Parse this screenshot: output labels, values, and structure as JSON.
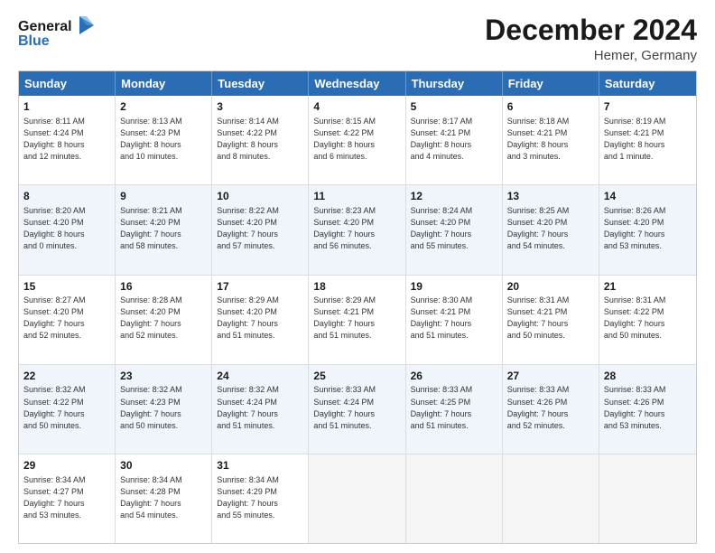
{
  "header": {
    "logo_general": "General",
    "logo_blue": "Blue",
    "month_title": "December 2024",
    "location": "Hemer, Germany"
  },
  "days_of_week": [
    "Sunday",
    "Monday",
    "Tuesday",
    "Wednesday",
    "Thursday",
    "Friday",
    "Saturday"
  ],
  "weeks": [
    {
      "alt": false,
      "cells": [
        {
          "day": "1",
          "lines": [
            "Sunrise: 8:11 AM",
            "Sunset: 4:24 PM",
            "Daylight: 8 hours",
            "and 12 minutes."
          ]
        },
        {
          "day": "2",
          "lines": [
            "Sunrise: 8:13 AM",
            "Sunset: 4:23 PM",
            "Daylight: 8 hours",
            "and 10 minutes."
          ]
        },
        {
          "day": "3",
          "lines": [
            "Sunrise: 8:14 AM",
            "Sunset: 4:22 PM",
            "Daylight: 8 hours",
            "and 8 minutes."
          ]
        },
        {
          "day": "4",
          "lines": [
            "Sunrise: 8:15 AM",
            "Sunset: 4:22 PM",
            "Daylight: 8 hours",
            "and 6 minutes."
          ]
        },
        {
          "day": "5",
          "lines": [
            "Sunrise: 8:17 AM",
            "Sunset: 4:21 PM",
            "Daylight: 8 hours",
            "and 4 minutes."
          ]
        },
        {
          "day": "6",
          "lines": [
            "Sunrise: 8:18 AM",
            "Sunset: 4:21 PM",
            "Daylight: 8 hours",
            "and 3 minutes."
          ]
        },
        {
          "day": "7",
          "lines": [
            "Sunrise: 8:19 AM",
            "Sunset: 4:21 PM",
            "Daylight: 8 hours",
            "and 1 minute."
          ]
        }
      ]
    },
    {
      "alt": true,
      "cells": [
        {
          "day": "8",
          "lines": [
            "Sunrise: 8:20 AM",
            "Sunset: 4:20 PM",
            "Daylight: 8 hours",
            "and 0 minutes."
          ]
        },
        {
          "day": "9",
          "lines": [
            "Sunrise: 8:21 AM",
            "Sunset: 4:20 PM",
            "Daylight: 7 hours",
            "and 58 minutes."
          ]
        },
        {
          "day": "10",
          "lines": [
            "Sunrise: 8:22 AM",
            "Sunset: 4:20 PM",
            "Daylight: 7 hours",
            "and 57 minutes."
          ]
        },
        {
          "day": "11",
          "lines": [
            "Sunrise: 8:23 AM",
            "Sunset: 4:20 PM",
            "Daylight: 7 hours",
            "and 56 minutes."
          ]
        },
        {
          "day": "12",
          "lines": [
            "Sunrise: 8:24 AM",
            "Sunset: 4:20 PM",
            "Daylight: 7 hours",
            "and 55 minutes."
          ]
        },
        {
          "day": "13",
          "lines": [
            "Sunrise: 8:25 AM",
            "Sunset: 4:20 PM",
            "Daylight: 7 hours",
            "and 54 minutes."
          ]
        },
        {
          "day": "14",
          "lines": [
            "Sunrise: 8:26 AM",
            "Sunset: 4:20 PM",
            "Daylight: 7 hours",
            "and 53 minutes."
          ]
        }
      ]
    },
    {
      "alt": false,
      "cells": [
        {
          "day": "15",
          "lines": [
            "Sunrise: 8:27 AM",
            "Sunset: 4:20 PM",
            "Daylight: 7 hours",
            "and 52 minutes."
          ]
        },
        {
          "day": "16",
          "lines": [
            "Sunrise: 8:28 AM",
            "Sunset: 4:20 PM",
            "Daylight: 7 hours",
            "and 52 minutes."
          ]
        },
        {
          "day": "17",
          "lines": [
            "Sunrise: 8:29 AM",
            "Sunset: 4:20 PM",
            "Daylight: 7 hours",
            "and 51 minutes."
          ]
        },
        {
          "day": "18",
          "lines": [
            "Sunrise: 8:29 AM",
            "Sunset: 4:21 PM",
            "Daylight: 7 hours",
            "and 51 minutes."
          ]
        },
        {
          "day": "19",
          "lines": [
            "Sunrise: 8:30 AM",
            "Sunset: 4:21 PM",
            "Daylight: 7 hours",
            "and 51 minutes."
          ]
        },
        {
          "day": "20",
          "lines": [
            "Sunrise: 8:31 AM",
            "Sunset: 4:21 PM",
            "Daylight: 7 hours",
            "and 50 minutes."
          ]
        },
        {
          "day": "21",
          "lines": [
            "Sunrise: 8:31 AM",
            "Sunset: 4:22 PM",
            "Daylight: 7 hours",
            "and 50 minutes."
          ]
        }
      ]
    },
    {
      "alt": true,
      "cells": [
        {
          "day": "22",
          "lines": [
            "Sunrise: 8:32 AM",
            "Sunset: 4:22 PM",
            "Daylight: 7 hours",
            "and 50 minutes."
          ]
        },
        {
          "day": "23",
          "lines": [
            "Sunrise: 8:32 AM",
            "Sunset: 4:23 PM",
            "Daylight: 7 hours",
            "and 50 minutes."
          ]
        },
        {
          "day": "24",
          "lines": [
            "Sunrise: 8:32 AM",
            "Sunset: 4:24 PM",
            "Daylight: 7 hours",
            "and 51 minutes."
          ]
        },
        {
          "day": "25",
          "lines": [
            "Sunrise: 8:33 AM",
            "Sunset: 4:24 PM",
            "Daylight: 7 hours",
            "and 51 minutes."
          ]
        },
        {
          "day": "26",
          "lines": [
            "Sunrise: 8:33 AM",
            "Sunset: 4:25 PM",
            "Daylight: 7 hours",
            "and 51 minutes."
          ]
        },
        {
          "day": "27",
          "lines": [
            "Sunrise: 8:33 AM",
            "Sunset: 4:26 PM",
            "Daylight: 7 hours",
            "and 52 minutes."
          ]
        },
        {
          "day": "28",
          "lines": [
            "Sunrise: 8:33 AM",
            "Sunset: 4:26 PM",
            "Daylight: 7 hours",
            "and 53 minutes."
          ]
        }
      ]
    },
    {
      "alt": false,
      "cells": [
        {
          "day": "29",
          "lines": [
            "Sunrise: 8:34 AM",
            "Sunset: 4:27 PM",
            "Daylight: 7 hours",
            "and 53 minutes."
          ]
        },
        {
          "day": "30",
          "lines": [
            "Sunrise: 8:34 AM",
            "Sunset: 4:28 PM",
            "Daylight: 7 hours",
            "and 54 minutes."
          ]
        },
        {
          "day": "31",
          "lines": [
            "Sunrise: 8:34 AM",
            "Sunset: 4:29 PM",
            "Daylight: 7 hours",
            "and 55 minutes."
          ]
        },
        {
          "day": "",
          "lines": []
        },
        {
          "day": "",
          "lines": []
        },
        {
          "day": "",
          "lines": []
        },
        {
          "day": "",
          "lines": []
        }
      ]
    }
  ]
}
